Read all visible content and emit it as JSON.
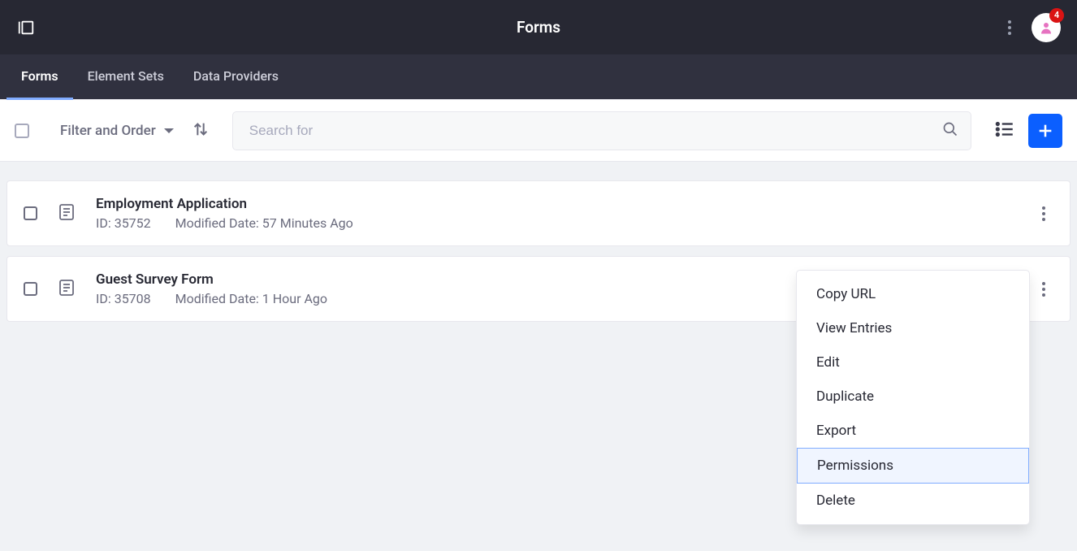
{
  "topbar": {
    "title": "Forms",
    "badge_count": "4"
  },
  "tabs": [
    {
      "label": "Forms",
      "active": true
    },
    {
      "label": "Element Sets",
      "active": false
    },
    {
      "label": "Data Providers",
      "active": false
    }
  ],
  "toolbar": {
    "filter_label": "Filter and Order",
    "search_placeholder": "Search for"
  },
  "rows": [
    {
      "title": "Employment Application",
      "id_label": "ID: 35752",
      "modified_label": "Modified Date: 57 Minutes Ago"
    },
    {
      "title": "Guest Survey Form",
      "id_label": "ID: 35708",
      "modified_label": "Modified Date: 1 Hour Ago"
    }
  ],
  "dropdown": {
    "items": [
      {
        "label": "Copy URL",
        "highlight": false
      },
      {
        "label": "View Entries",
        "highlight": false
      },
      {
        "label": "Edit",
        "highlight": false
      },
      {
        "label": "Duplicate",
        "highlight": false
      },
      {
        "label": "Export",
        "highlight": false
      },
      {
        "label": "Permissions",
        "highlight": true
      },
      {
        "label": "Delete",
        "highlight": false
      }
    ]
  }
}
